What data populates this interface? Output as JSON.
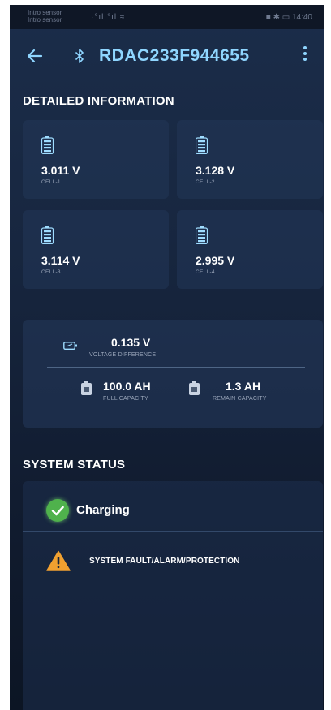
{
  "status_bar": {
    "left_line1": "Intro sensor",
    "left_line2": "Intro sensor",
    "signal": "·°ıl °ıl ≈",
    "right": "■ ✱ ▭ 14:40"
  },
  "app_bar": {
    "back_icon": "arrow-left-icon",
    "bluetooth_icon": "bluetooth-icon",
    "device_name": "RDAC233F944655",
    "menu_icon": "more-vertical-icon"
  },
  "detailed_info": {
    "title": "DETAILED INFORMATION",
    "cells": [
      {
        "value": "3.011 V",
        "label": "CELL-1"
      },
      {
        "value": "3.128 V",
        "label": "CELL-2"
      },
      {
        "value": "3.114 V",
        "label": "CELL-3"
      },
      {
        "value": "2.995 V",
        "label": "CELL-4"
      }
    ]
  },
  "summary": {
    "voltage_difference": {
      "value": "0.135 V",
      "label": "VOLTAGE DIFFERENCE"
    },
    "full_capacity": {
      "value": "100.0 AH",
      "label": "FULL CAPACITY"
    },
    "remain_capacity": {
      "value": "1.3 AH",
      "label": "REMAIN CAPACITY"
    }
  },
  "system_status": {
    "title": "SYSTEM STATUS",
    "charging_label": "Charging",
    "fault_label": "SYSTEM FAULT/ALARM/PROTECTION"
  },
  "colors": {
    "accent": "#8fd6ff",
    "ok": "#4fb24c",
    "warning": "#f0a030"
  }
}
